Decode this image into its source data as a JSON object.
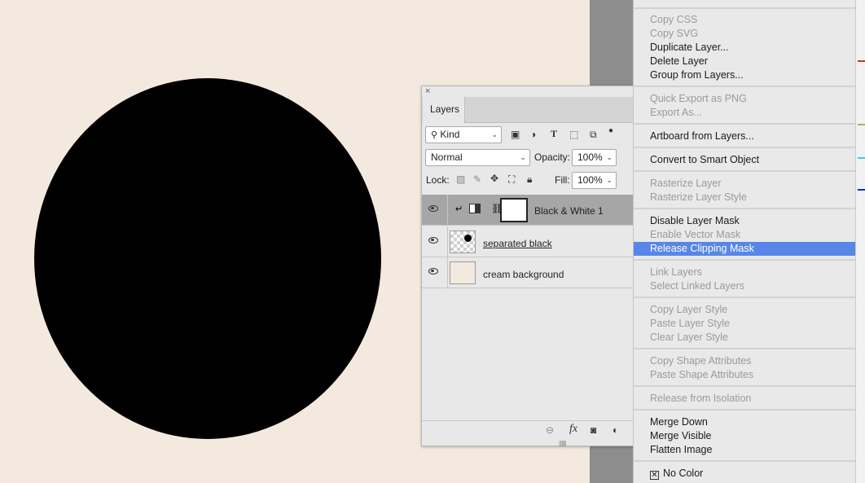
{
  "layers_panel": {
    "tab_label": "Layers",
    "close_glyph": "×",
    "filter": {
      "value": "Kind"
    },
    "blend_mode": {
      "value": "Normal"
    },
    "opacity": {
      "label": "Opacity:",
      "value": "100%"
    },
    "lock": {
      "label": "Lock:"
    },
    "fill": {
      "label": "Fill:",
      "value": "100%"
    },
    "layers": [
      {
        "name": "Black & White 1",
        "selected": true
      },
      {
        "name": "separated black",
        "selected": false
      },
      {
        "name": "cream background",
        "selected": false
      }
    ],
    "footer": {
      "fx_label": "fx"
    }
  },
  "context_menu": {
    "items": [
      {
        "label": "Copy CSS",
        "enabled": false
      },
      {
        "label": "Copy SVG",
        "enabled": false
      },
      {
        "label": "Duplicate Layer...",
        "enabled": true
      },
      {
        "label": "Delete Layer",
        "enabled": true
      },
      {
        "label": "Group from Layers...",
        "enabled": true
      },
      {
        "label": "Quick Export as PNG",
        "enabled": false
      },
      {
        "label": "Export As...",
        "enabled": false
      },
      {
        "label": "Artboard from Layers...",
        "enabled": true
      },
      {
        "label": "Convert to Smart Object",
        "enabled": true
      },
      {
        "label": "Rasterize Layer",
        "enabled": false
      },
      {
        "label": "Rasterize Layer Style",
        "enabled": false
      },
      {
        "label": "Disable Layer Mask",
        "enabled": true
      },
      {
        "label": "Enable Vector Mask",
        "enabled": false
      },
      {
        "label": "Release Clipping Mask",
        "enabled": true,
        "highlighted": true
      },
      {
        "label": "Link Layers",
        "enabled": false
      },
      {
        "label": "Select Linked Layers",
        "enabled": false
      },
      {
        "label": "Copy Layer Style",
        "enabled": false
      },
      {
        "label": "Paste Layer Style",
        "enabled": false
      },
      {
        "label": "Clear Layer Style",
        "enabled": false
      },
      {
        "label": "Copy Shape Attributes",
        "enabled": false
      },
      {
        "label": "Paste Shape Attributes",
        "enabled": false
      },
      {
        "label": "Release from Isolation",
        "enabled": false
      },
      {
        "label": "Merge Down",
        "enabled": true
      },
      {
        "label": "Merge Visible",
        "enabled": true
      },
      {
        "label": "Flatten Image",
        "enabled": true
      },
      {
        "label": "No Color",
        "enabled": true
      }
    ]
  },
  "colors": {
    "canvas": "#f4e9de",
    "circle": "#000000",
    "menu_highlight": "#5786e8",
    "strip_marks": [
      "#c0392b",
      "#8bc34a",
      "#4fc3d9",
      "#1a2fa8"
    ]
  }
}
